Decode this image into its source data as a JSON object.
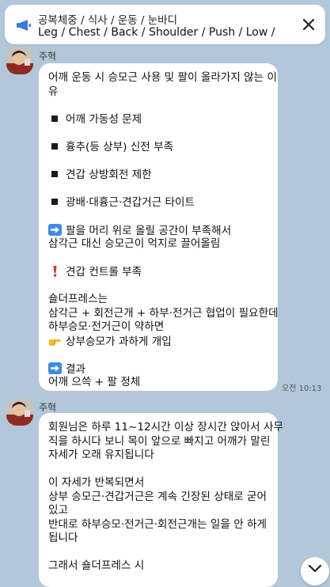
{
  "notice": {
    "title": "공복체중 / 식사 / 운동 / 눈바디",
    "preview": "Leg / Chest / Back / Shoulder / Push / Low / Cir..."
  },
  "messages": [
    {
      "sender": "주혁",
      "time": "오전 10:13",
      "lines": {
        "l1": "어깨 운동 시 승모근 사용 및 팔이 올라가지 않는 이",
        "l2": "유",
        "b1": "어깨 가동성 문제",
        "b2": "흉추(등 상부) 신전 부족",
        "b3": "견갑 상방회전 제한",
        "b4": "광배·대흉근·견갑거근 타이트",
        "a1": "팔을 머리 위로 올릴 공간이 부족해서",
        "a2": "삼각근 대신 승모근이 억지로 끌어올림",
        "w1": "견갑 컨트롤 부족",
        "s1": "숄더프레스는",
        "s2": "삼각근 + 회전근개 + 하부·전거근 협업이 필요한데",
        "s3": "하부승모·전거근이 약하면",
        "s4": "상부승모가 과하게 개입",
        "r1": "결과",
        "r2": "어깨 으쓱 + 팔 정체"
      }
    },
    {
      "sender": "주혁",
      "lines": {
        "m1": "회원님은 하루 11~12시간 이상 장시간 앉아서 사무",
        "m2": "직을 하시다 보니 목이 앞으로 빠지고 어깨가 말린",
        "m3": "자세가 오래 유지됩니다",
        "m4": "이 자세가 반복되면서",
        "m5": "상부 승모근·견갑거근은 계속 긴장된 상태로 굳어",
        "m6": "있고",
        "m7": "반대로 하부승모·전거근·회전근개는 일을 안 하게",
        "m8": "됩니다",
        "m9": "그래서 숄더프레스 시"
      }
    }
  ],
  "icons": {
    "notice": "megaphone-icon",
    "close": "close-icon",
    "bullet": "black-square-icon",
    "arrow": "right-arrow-emoji-icon",
    "warning": "red-exclamation-emoji-icon",
    "pointer": "pointing-hand-emoji-icon",
    "scroll": "chevron-down-icon"
  },
  "colors": {
    "chat_background": "#b2c7d9",
    "bubble": "#ffffff",
    "notice_accent": "#3a7bd5"
  }
}
